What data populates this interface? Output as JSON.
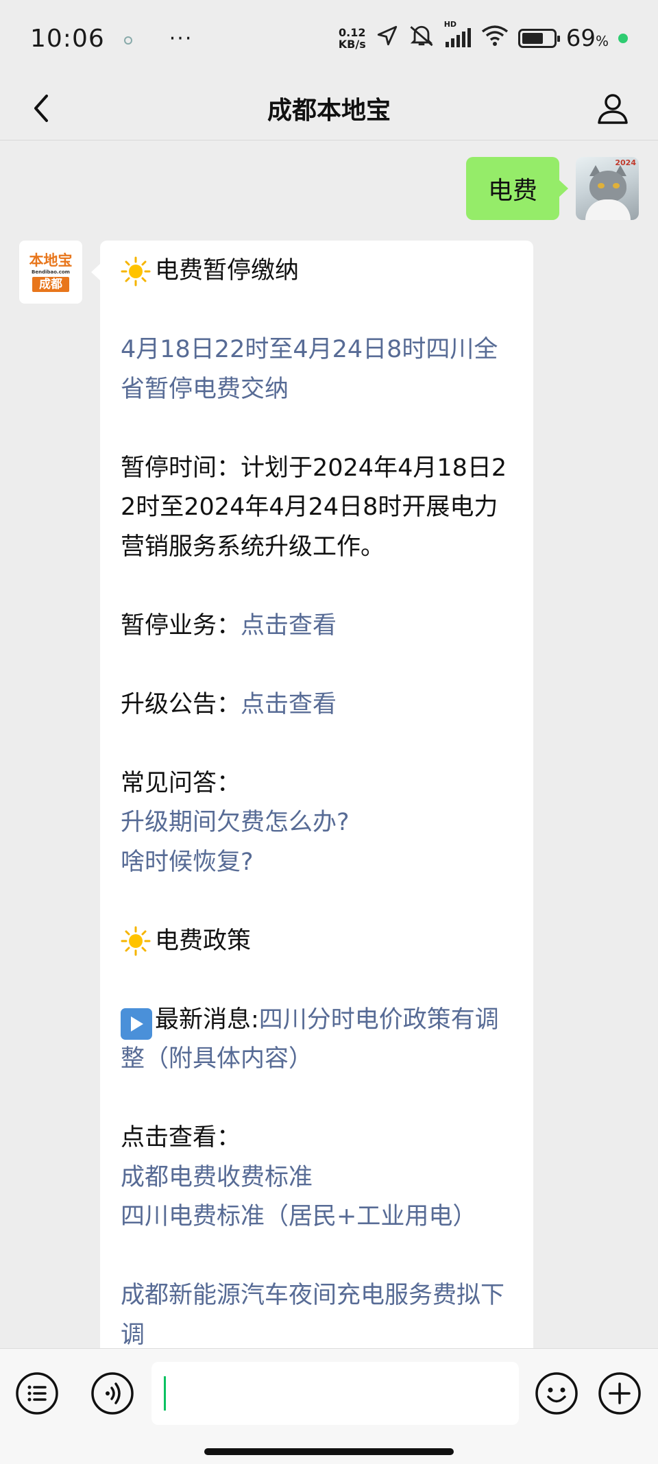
{
  "status_bar": {
    "time": "10:06",
    "dots": "···",
    "net_speed_value": "0.12",
    "net_speed_unit": "KB/s",
    "network_label": "HD",
    "battery_percent": "69",
    "battery_unit": "%",
    "battery_level": 0.69
  },
  "nav": {
    "title": "成都本地宝"
  },
  "messages": {
    "outgoing": {
      "text": "电费",
      "avatar_year": "2024"
    },
    "incoming": {
      "avatar": {
        "logo_text": "本地宝",
        "logo_url": "Bendibao.com",
        "logo_city": "成都"
      },
      "heading1": "电费暂停缴纳",
      "notice": "4月18日22时至4月24日8时四川全省暂停电费交纳",
      "time_text": "暂停时间：计划于2024年4月18日22时至2024年4月24日8时开展电力营销服务系统升级工作。",
      "biz_label": "暂停业务：",
      "biz_link": "点击查看",
      "upgrade_label": "升级公告：",
      "upgrade_link": "点击查看",
      "faq_label": "常见问答：",
      "faq_link1": "升级期间欠费怎么办?",
      "faq_link2": "啥时候恢复?",
      "heading2": "电费政策",
      "news_label": "最新消息:",
      "news_link": "四川分时电价政策有调整（附具体内容）",
      "view_label": "点击查看：",
      "view_link1": "成都电费收费标准",
      "view_link2": "四川电费标准（居民+工业用电）",
      "ev_link": "成都新能源汽车夜间充电服务费拟下调"
    }
  },
  "icons": {
    "back": "chevron-left-icon",
    "profile": "person-icon",
    "menu": "list-icon",
    "voice": "voice-icon",
    "emoji": "emoji-icon",
    "plus": "plus-icon",
    "sun": "sun-emoji",
    "play": "play-button-emoji"
  },
  "colors": {
    "outgoing_bubble": "#95ec69",
    "link": "#576b95",
    "accent": "#07c160",
    "brand_orange": "#e8761c"
  }
}
